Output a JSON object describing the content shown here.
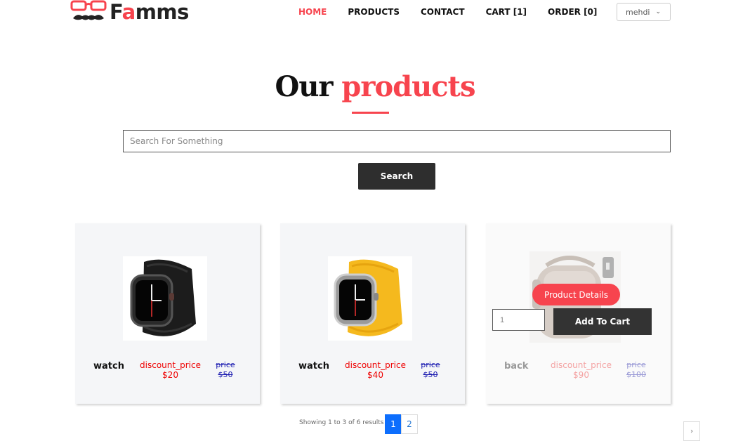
{
  "brand": {
    "prefix": "F",
    "accent": "a",
    "suffix": "mms",
    "accent_color": "#f7444e"
  },
  "nav": {
    "items": [
      {
        "label": "HOME",
        "active": true
      },
      {
        "label": "PRODUCTS",
        "active": false
      },
      {
        "label": "CONTACT",
        "active": false
      },
      {
        "label": "CART [1]",
        "active": false
      },
      {
        "label": "ORDER [0]",
        "active": false
      }
    ],
    "user": "mehdi"
  },
  "heading": {
    "part1": "Our",
    "part2": "products"
  },
  "search": {
    "placeholder": "Search For Something",
    "button": "Search"
  },
  "products": [
    {
      "name": "watch",
      "discount_label": "discount_price",
      "discount_value": "$20",
      "price_label": "price",
      "price_value": "$50",
      "image_icon": "black-watch"
    },
    {
      "name": "watch",
      "discount_label": "discount_price",
      "discount_value": "$40",
      "price_label": "price",
      "price_value": "$50",
      "image_icon": "yellow-watch"
    },
    {
      "name": "back",
      "discount_label": "discount_price",
      "discount_value": "$90",
      "price_label": "price",
      "price_value": "$100",
      "image_icon": "backpack"
    }
  ],
  "hover_card": {
    "details_button": "Product Details",
    "quantity": "1",
    "cart_button": "Add To Cart"
  },
  "pagination": {
    "info": "Showing 1 to 3 of 6 results",
    "prev": "‹",
    "next": "›",
    "pages": [
      "1",
      "2"
    ],
    "current": "1"
  },
  "colors": {
    "accent": "#f7444e",
    "dark": "#2e2e2e",
    "page_active": "#0d6efd"
  }
}
